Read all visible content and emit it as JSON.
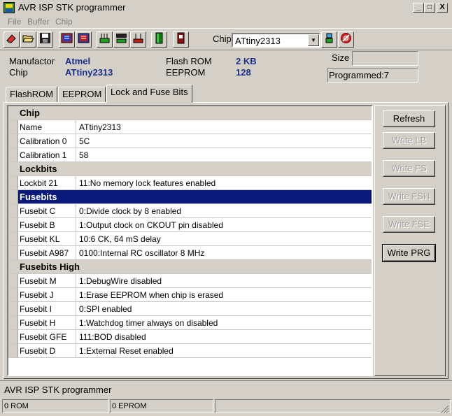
{
  "window": {
    "title": "AVR ISP STK programmer"
  },
  "title_buttons": {
    "minimize": "_",
    "maximize": "□",
    "close": "X"
  },
  "menu": [
    "File",
    "Buffer",
    "Chip"
  ],
  "toolbar": {
    "chip_label": "Chip",
    "chip_value": "ATtiny2313",
    "icons": [
      "erase-icon",
      "open-icon",
      "save-icon",
      "read-chip-icon",
      "read-all-icon",
      "write-chip-icon",
      "write-all-icon",
      "verify-icon",
      "chip-green-icon",
      "chip-red-icon",
      "chip-info-icon",
      "stop-icon"
    ]
  },
  "info": {
    "manufactor_label": "Manufactor",
    "manufactor_value": "Atmel",
    "chip_label": "Chip",
    "chip_value": "ATtiny2313",
    "flash_label": "Flash ROM",
    "flash_value": "2 KB",
    "eeprom_label": "EEPROM",
    "eeprom_value": "128",
    "size_label": "Size",
    "size_value": "",
    "programmed_text": "Programmed:7"
  },
  "tabs": [
    "FlashROM",
    "EEPROM",
    "Lock and Fuse Bits"
  ],
  "active_tab": 2,
  "grid": [
    {
      "type": "header",
      "name": "Chip"
    },
    {
      "type": "row",
      "name": "Name",
      "value": "ATtiny2313"
    },
    {
      "type": "row",
      "name": "Calibration 0",
      "value": "5C"
    },
    {
      "type": "row",
      "name": "Calibration 1",
      "value": "58"
    },
    {
      "type": "header",
      "name": "Lockbits"
    },
    {
      "type": "row",
      "name": "Lockbit 21",
      "value": "11:No memory lock features enabled"
    },
    {
      "type": "selected",
      "name": "Fusebits"
    },
    {
      "type": "row",
      "name": "Fusebit C",
      "value": "0:Divide clock by 8 enabled"
    },
    {
      "type": "row",
      "name": "Fusebit B",
      "value": "1:Output clock on CKOUT pin disabled"
    },
    {
      "type": "row",
      "name": "Fusebit KL",
      "value": "10:6 CK, 64 mS delay"
    },
    {
      "type": "row",
      "name": "Fusebit A987",
      "value": "0100:Internal RC oscillator 8 MHz"
    },
    {
      "type": "header",
      "name": "Fusebits High"
    },
    {
      "type": "row",
      "name": "Fusebit M",
      "value": "1:DebugWire disabled"
    },
    {
      "type": "row",
      "name": "Fusebit J",
      "value": "1:Erase EEPROM when chip is erased"
    },
    {
      "type": "row",
      "name": "Fusebit I",
      "value": "0:SPI enabled"
    },
    {
      "type": "row",
      "name": "Fusebit H",
      "value": "1:Watchdog timer always on disabled"
    },
    {
      "type": "row",
      "name": "Fusebit GFE",
      "value": "111:BOD disabled"
    },
    {
      "type": "row",
      "name": "Fusebit D",
      "value": "1:External Reset enabled"
    }
  ],
  "buttons": [
    {
      "label": "Refresh",
      "enabled": true
    },
    {
      "label": "Write LB",
      "enabled": false
    },
    {
      "label": "Write FS",
      "enabled": false
    },
    {
      "label": "Write FSH",
      "enabled": false
    },
    {
      "label": "Write FSE",
      "enabled": false
    },
    {
      "label": "Write PRG",
      "enabled": true
    }
  ],
  "status": {
    "line": "AVR ISP STK programmer",
    "rom": "0 ROM",
    "eprom": "0 EPROM"
  }
}
